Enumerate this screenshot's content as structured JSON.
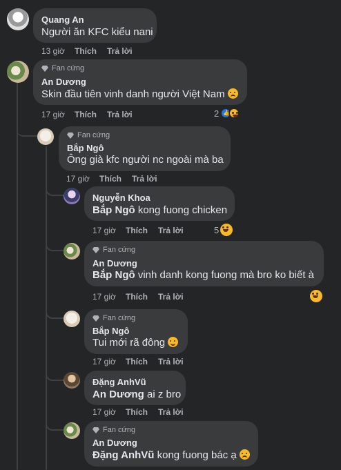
{
  "badge_label": "Fan cứng",
  "like_label": "Thích",
  "reply_label": "Trả lời",
  "comments": [
    {
      "author": "Quang An",
      "text": "Người ăn KFC kiểu nani",
      "time": "13 giờ",
      "fan_badge": false
    },
    {
      "author": "An Dương",
      "text": "Skin đầu tiên vinh danh người Việt Nam",
      "text_emoji": "sad-face-icon",
      "time": "17 giờ",
      "fan_badge": true,
      "reactions": {
        "count": "2",
        "types": [
          "like",
          "haha"
        ]
      }
    },
    {
      "author": "Bắp Ngô",
      "text": "Ông già kfc người nc ngoài mà ba",
      "time": "17 giờ",
      "fan_badge": true
    },
    {
      "author": "Nguyễn Khoa",
      "mention": "Bắp Ngô",
      "text": "kong fuong chicken",
      "time": "17 giờ",
      "fan_badge": false,
      "reactions": {
        "count": "5",
        "types": [
          "haha"
        ]
      }
    },
    {
      "author": "An Dương",
      "mention": "Bắp Ngô",
      "text": "vinh danh kong fuong mà bro ko biết à",
      "time": "17 giờ",
      "fan_badge": true,
      "reactions": {
        "count": "",
        "types": [
          "haha"
        ]
      }
    },
    {
      "author": "Bắp Ngô",
      "text": "Tui mới rã đông",
      "text_emoji": "smile-face-icon",
      "time": "17 giờ",
      "fan_badge": true
    },
    {
      "author": "Đặng AnhVũ",
      "mention": "An Dương",
      "text": "ai z bro",
      "time": "17 giờ",
      "fan_badge": false
    },
    {
      "author": "An Dương",
      "mention": "Đặng AnhVũ",
      "text": "kong fuong bác ạ",
      "text_emoji": "sad-face-icon",
      "time": "",
      "fan_badge": true
    }
  ],
  "colors": {
    "background": "#242526",
    "bubble": "#3a3b3c",
    "text": "#e4e6eb",
    "secondary": "#b0b3b8",
    "thread_line": "#3e4042"
  }
}
